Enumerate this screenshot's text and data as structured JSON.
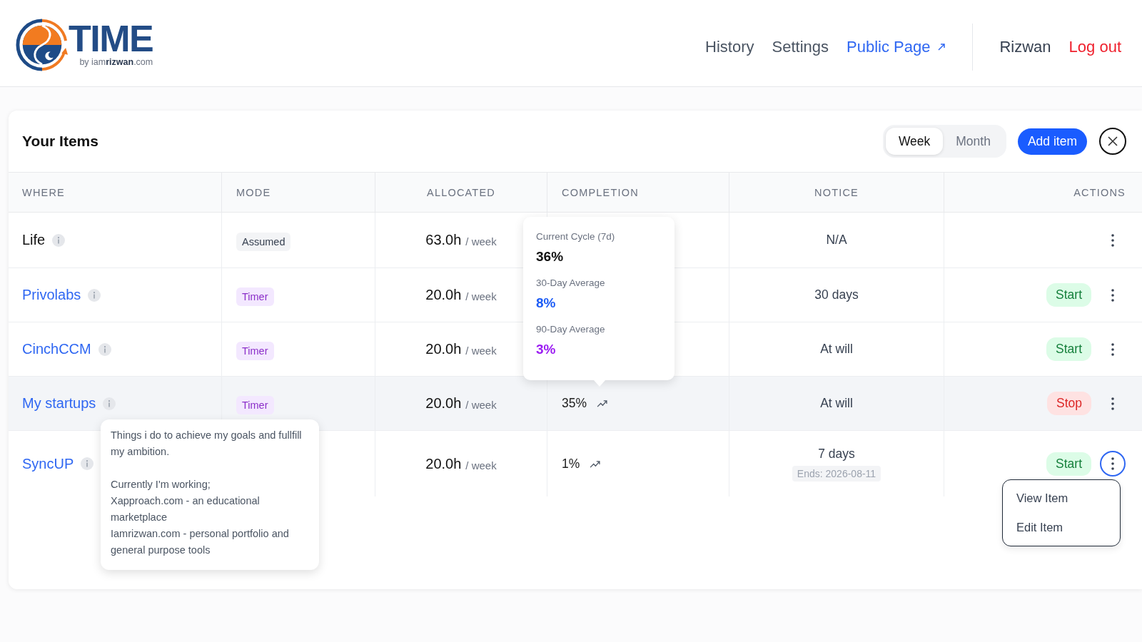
{
  "header": {
    "logo": {
      "wordmark": "TIME",
      "byline": "by iam**rizwan**.com"
    },
    "nav": [
      {
        "label": "History",
        "external": false
      },
      {
        "label": "Settings",
        "external": false
      },
      {
        "label": "Public Page",
        "external": true
      }
    ],
    "user": {
      "name": "Rizwan"
    },
    "logout": {
      "label": "Log out"
    }
  },
  "panel": {
    "title": "Your Items",
    "periods": [
      {
        "label": "Week",
        "selected": true
      },
      {
        "label": "Month",
        "selected": false
      }
    ],
    "add_button": "Add item"
  },
  "table": {
    "columns": [
      "WHERE",
      "MODE",
      "ALLOCATED",
      "COMPLETION",
      "NOTICE",
      "ACTIONS"
    ],
    "rows": [
      {
        "name": "Life",
        "linked": false,
        "mode": {
          "label": "Assumed",
          "kind": "assumed"
        },
        "allocated": "63.0h",
        "unit": "/ week",
        "notice": "N/A",
        "hovered": false,
        "menu_open": false
      },
      {
        "name": "Privolabs",
        "linked": true,
        "mode": {
          "label": "Timer",
          "kind": "timer"
        },
        "allocated": "20.0h",
        "unit": "/ week",
        "notice": "30 days",
        "action": {
          "label": "Start",
          "kind": "start"
        },
        "hovered": false,
        "menu_open": false
      },
      {
        "name": "CinchCCM",
        "linked": true,
        "mode": {
          "label": "Timer",
          "kind": "timer"
        },
        "allocated": "20.0h",
        "unit": "/ week",
        "notice": "At will",
        "action": {
          "label": "Start",
          "kind": "start"
        },
        "hovered": false,
        "menu_open": false
      },
      {
        "name": "My startups",
        "linked": true,
        "mode": {
          "label": "Timer",
          "kind": "timer"
        },
        "allocated": "20.0h",
        "unit": "/ week",
        "completion": "35%",
        "popover": {
          "stats": [
            {
              "label": "Current Cycle (7d)",
              "value": "36%",
              "color": "#111111"
            },
            {
              "label": "30-Day Average",
              "value": "8%",
              "color": "#1d5cf5"
            },
            {
              "label": "90-Day Average",
              "value": "3%",
              "color": "#9b1cf2"
            }
          ]
        },
        "notice": "At will",
        "action": {
          "label": "Stop",
          "kind": "stop"
        },
        "hovered": true,
        "menu_open": false
      },
      {
        "name": "SyncUP",
        "linked": true,
        "info_tooltip": {
          "paragraphs": [
            {
              "lines": [
                "Things i do to achieve my goals and fullfill my ambition."
              ]
            },
            {
              "lines": [
                "Currently I'm working;",
                "Xapproach.com - an educational marketplace",
                "Iamrizwan.com - personal portfolio and general purpose tools"
              ]
            }
          ]
        },
        "allocated": "20.0h",
        "unit": "/ week",
        "completion": "1%",
        "notice": "7 days",
        "notice_note": "Ends: 2026-08-11",
        "action": {
          "label": "Start",
          "kind": "start"
        },
        "hovered": false,
        "menu_open": true,
        "menu": [
          {
            "label": "View Item"
          },
          {
            "label": "Edit Item"
          }
        ]
      }
    ]
  }
}
